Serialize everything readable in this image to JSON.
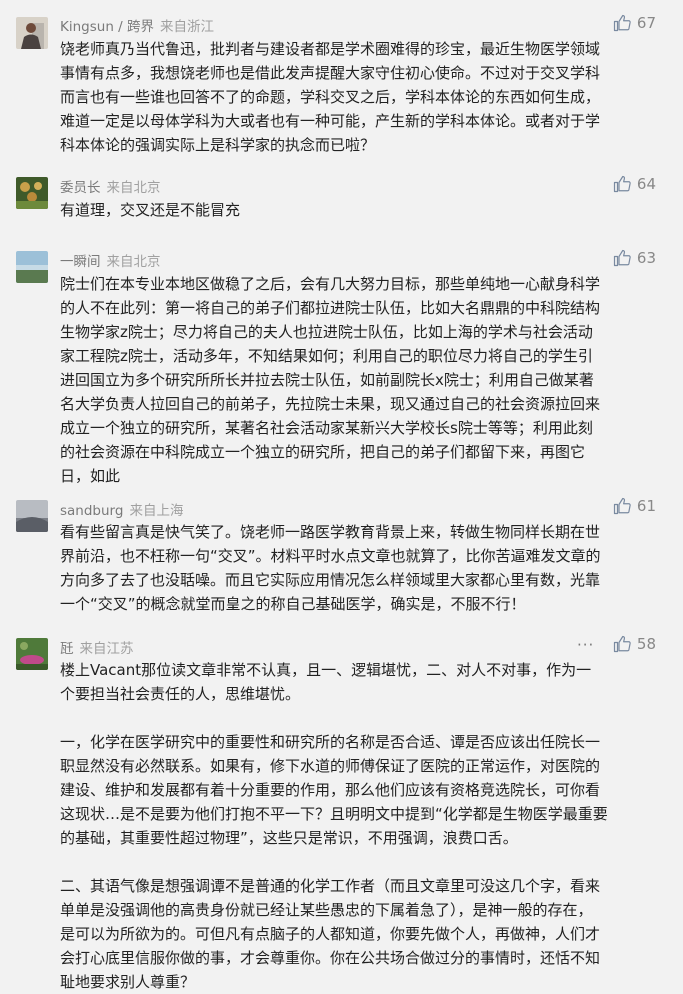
{
  "comments": [
    {
      "name": "Kingsun / 跨界",
      "location": "来自浙江",
      "likes": "67",
      "text": "饶老师真乃当代鲁迅，批判者与建设者都是学术圈难得的珍宝，最近生物医学领域\n事情有点多，我想饶老师也是借此发声提醒大家守住初心使命。不过对于交叉学科\n而言也有一些谁也回答不了的命题，学科交叉之后，学科本体论的东西如何生成，\n难道一定是以母体学科为大或者也有一种可能，产生新的学科本体论。或者对于学\n科本体论的强调实际上是科学家的执念而已啦？",
      "avatar_colors": [
        "#d8d2c8",
        "#6e4a3a"
      ]
    },
    {
      "name": "委员长",
      "location": "来自北京",
      "likes": "64",
      "text": "有道理，交叉还是不能冒充",
      "avatar_colors": [
        "#6d8a3c",
        "#c8a04a"
      ]
    },
    {
      "name": "一瞬间",
      "location": "来自北京",
      "likes": "63",
      "text": "院士们在本专业本地区做稳了之后，会有几大努力目标，那些单纯地一心献身科学\n的人不在此列：第一将自己的弟子们都拉进院士队伍，比如大名鼎鼎的中科院结构\n生物学家z院士；尽力将自己的夫人也拉进院士队伍，比如上海的学术与社会活动\n家工程院z院士，活动多年，不知结果如何；利用自己的职位尽力将自己的学生引\n进回国立为多个研究所所长并拉去院士队伍，如前副院长x院士；利用自己做某著\n名大学负责人拉回自己的前弟子，先拉院士未果，现又通过自己的社会资源拉回来\n成立一个独立的研究所，某著名社会活动家某新兴大学校长s院士等等；利用此刻\n的社会资源在中科院成立一个独立的研究所，把自己的弟子们都留下来，再图它\n日，如此",
      "avatar_colors": [
        "#9cc0d8",
        "#5a7a50"
      ]
    },
    {
      "name": "sandburg",
      "location": "来自上海",
      "likes": "61",
      "text": "看有些留言真是快气笑了。饶老师一路医学教育背景上来，转做生物同样长期在世\n界前沿，也不枉称一句“交叉”。材料平时水点文章也就算了，比你苦逼难发文章的\n方向多了去了也没聒噪。而且它实际应用情况怎么样领域里大家都心里有数，光靠\n一个“交叉”的概念就堂而皇之的称自己基础医学，确实是，不服不行！",
      "avatar_colors": [
        "#b8bcc2",
        "#5a5e66"
      ]
    },
    {
      "name": "瓩",
      "location": "来自江苏",
      "likes": "58",
      "more": "···",
      "text": "楼上Vacant那位读文章非常不认真，且一、逻辑堪忧，二、对人不对事，作为一\n个要担当社会责任的人，思维堪忧。\n\n一，化学在医学研究中的重要性和研究所的名称是否合适、谭是否应该出任院长一\n职显然没有必然联系。如果有，修下水道的师傅保证了医院的正常运作，对医院的\n建设、维护和发展都有着十分重要的作用，那么他们应该有资格竞选院长，可你看\n这现状…是不是要为他们打抱不平一下？且明明文中提到“化学都是生物医学最重要\n的基础，其重要性超过物理”，这些只是常识，不用强调，浪费口舌。\n\n二、其语气像是想强调谭不是普通的化学工作者（而且文章里可没这几个字，看来\n单单是没强调他的高贵身份就已经让某些愚忠的下属着急了），是神一般的存在，\n是可以为所欲为的。可但凡有点脑子的人都知道，你要先做个人，再做神，人们才\n会打心底里信服你做的事，才会尊重你。你在公共场合做过分的事情时，还恬不知\n耻地要求别人尊重？",
      "avatar_colors": [
        "#4f7a3a",
        "#c04a8a"
      ]
    }
  ]
}
